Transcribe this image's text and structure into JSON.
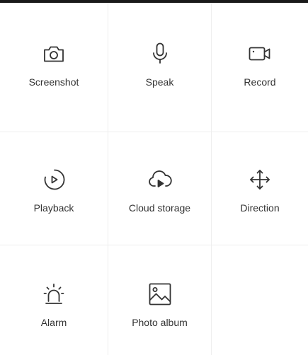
{
  "controls": [
    {
      "label": "Screenshot",
      "icon": "camera-icon"
    },
    {
      "label": "Speak",
      "icon": "microphone-icon"
    },
    {
      "label": "Record",
      "icon": "video-camera-icon"
    },
    {
      "label": "Playback",
      "icon": "playback-icon"
    },
    {
      "label": "Cloud storage",
      "icon": "cloud-play-icon"
    },
    {
      "label": "Direction",
      "icon": "direction-arrows-icon"
    },
    {
      "label": "Alarm",
      "icon": "siren-icon"
    },
    {
      "label": "Photo album",
      "icon": "image-icon"
    }
  ]
}
